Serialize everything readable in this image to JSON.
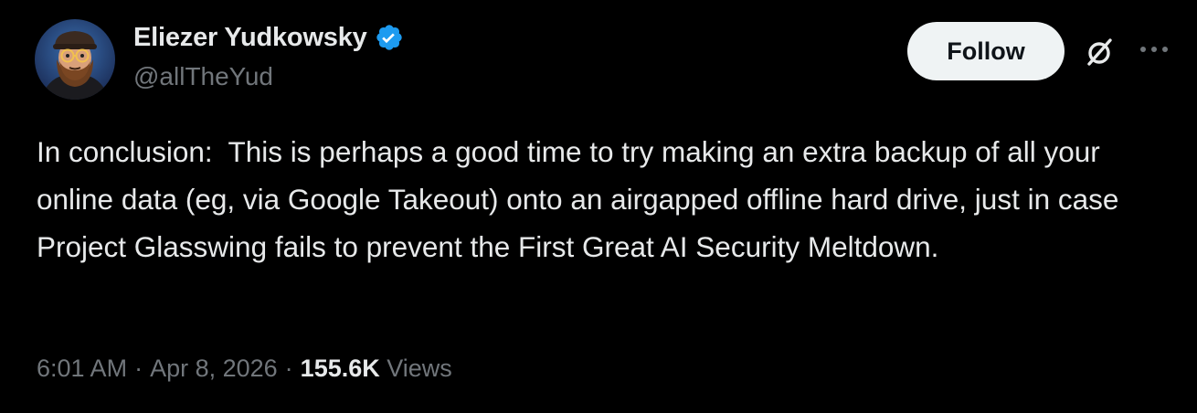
{
  "author": {
    "display_name": "Eliezer Yudkowsky",
    "handle": "@allTheYud",
    "verified": true
  },
  "actions": {
    "follow_label": "Follow",
    "grok_icon": "grok-icon",
    "more_icon": "more-icon"
  },
  "tweet": {
    "text": "In conclusion:  This is perhaps a good time to try making an extra backup of all your online data (eg, via Google Takeout) onto an airgapped offline hard drive, just in case Project Glasswing fails to prevent the First Great AI Security Meltdown."
  },
  "meta": {
    "time": "6:01 AM",
    "separator": "·",
    "date": "Apr 8, 2026",
    "views_count": "155.6K",
    "views_label": "Views"
  },
  "colors": {
    "background": "#000000",
    "primary_text": "#e7e9ea",
    "secondary_text": "#71767b",
    "verified_badge": "#1d9bf0",
    "follow_button_bg": "#eff3f4"
  }
}
